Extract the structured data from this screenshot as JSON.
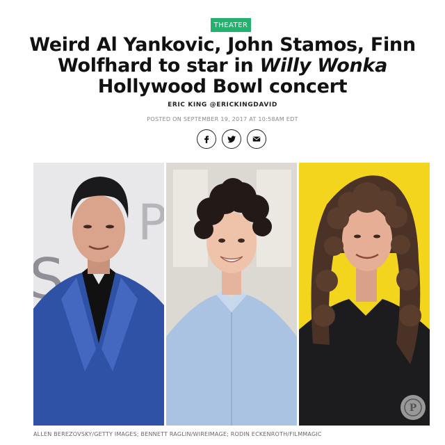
{
  "article": {
    "section_tag": "THEATER",
    "headline_part1": "Weird Al Yankovic, John Stamos, Finn Wolfhard to star in ",
    "headline_italic": "Willy Wonka",
    "headline_part2": " Hollywood Bowl concert",
    "byline": "ERIC KING @ERICKINGDAVID",
    "posted": "POSTED ON SEPTEMBER 19, 2017 AT 10:58AM EDT"
  },
  "share": {
    "icons": [
      "facebook-icon",
      "twitter-icon",
      "email-icon"
    ]
  },
  "photos": {
    "credit": "ALLEN BEREZOVSKY/GETTY IMAGES; BENNETT RAGLIN/WIREIMAGE; RODIN ECKENROTH/FILMMAGIC",
    "backdrop_text_1": "P",
    "backdrop_text_2": "S",
    "pin_label": "P"
  },
  "colors": {
    "tag": "#23b26d",
    "text": "#111111",
    "posted": "#8a8a8a"
  }
}
